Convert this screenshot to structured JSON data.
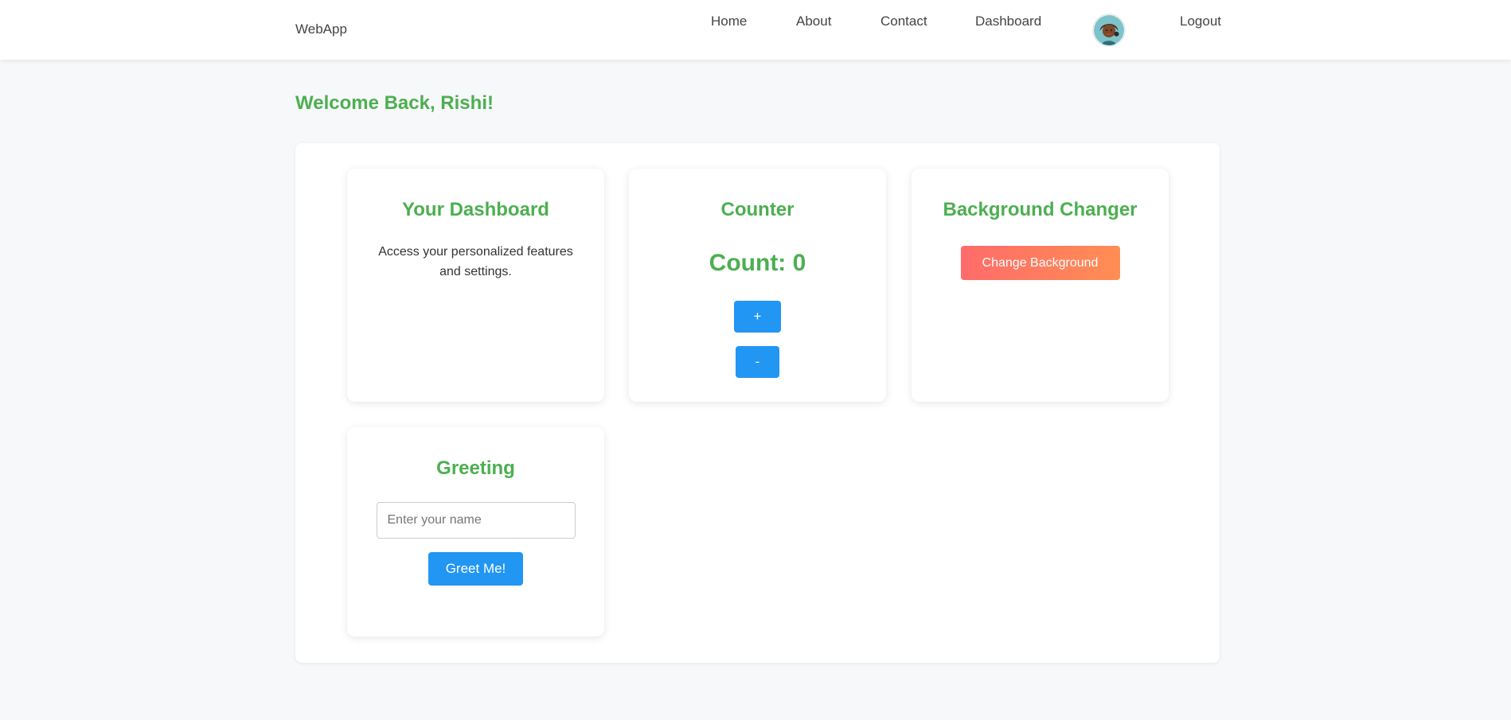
{
  "navbar": {
    "brand": "WebApp",
    "links": [
      "Home",
      "About",
      "Contact",
      "Dashboard"
    ],
    "logout": "Logout",
    "avatar_icon": "user-avatar-icon"
  },
  "welcome": "Welcome Back, Rishi!",
  "cards": {
    "dashboard": {
      "title": "Your Dashboard",
      "text": "Access your personalized features and settings."
    },
    "counter": {
      "title": "Counter",
      "count_text": "Count: 0",
      "plus_label": "+",
      "minus_label": "-"
    },
    "background": {
      "title": "Background Changer",
      "button_label": "Change Background"
    },
    "greeting": {
      "title": "Greeting",
      "input_value": "",
      "input_placeholder": "Enter your name",
      "button_label": "Greet Me!"
    }
  },
  "colors": {
    "accent_green": "#4caf50",
    "button_blue": "#2196f3",
    "gradient_start": "#ff6b6b",
    "gradient_end": "#ff8e53",
    "page_background": "#f7f8fa"
  }
}
